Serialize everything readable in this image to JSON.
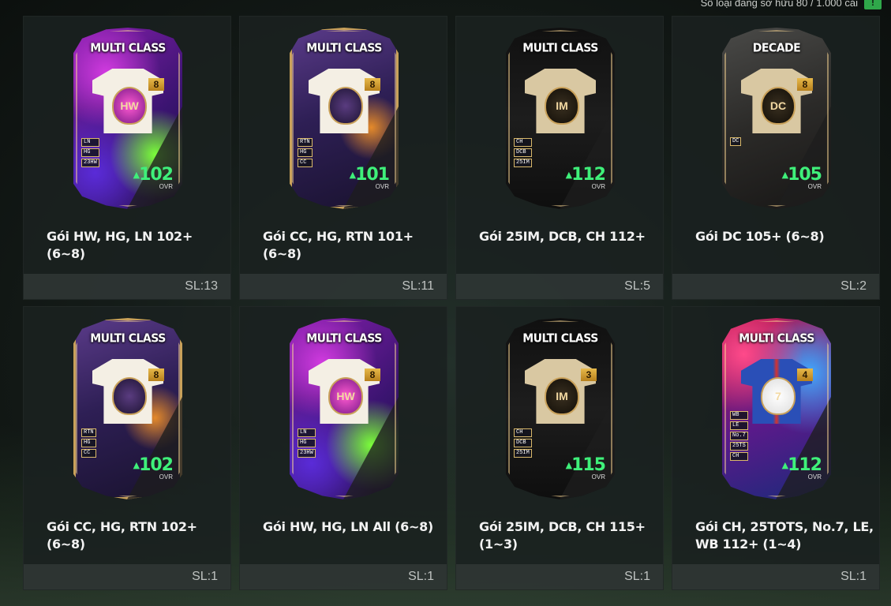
{
  "header": {
    "status_text": "Số loại đang sở hữu 80 / 1.000 cái",
    "action_icon": "!"
  },
  "packs": [
    {
      "title": "MULTI CLASS",
      "theme": "purple",
      "badge": "8",
      "positions": [
        "LN",
        "HG",
        "23HW"
      ],
      "ovr": "102",
      "ovr_label": "OVR",
      "crest": "HW",
      "name": "Gói HW, HG, LN 102+ (6~8)",
      "quantity": "SL:13"
    },
    {
      "title": "MULTI CLASS",
      "theme": "gold",
      "badge": "8",
      "positions": [
        "RTN",
        "HG",
        "CC"
      ],
      "ovr": "101",
      "ovr_label": "OVR",
      "crest": "",
      "name": "Gói CC, HG, RTN 101+ (6~8)",
      "quantity": "SL:11"
    },
    {
      "title": "MULTI CLASS",
      "theme": "black",
      "badge": "",
      "positions": [
        "CH",
        "DCB",
        "25IM"
      ],
      "ovr": "112",
      "ovr_label": "OVR",
      "crest": "IM",
      "name": "Gói 25IM, DCB, CH 112+",
      "quantity": "SL:5"
    },
    {
      "title": "DECADE",
      "theme": "decade",
      "badge": "8",
      "positions": [
        "DC"
      ],
      "ovr": "105",
      "ovr_label": "OVR",
      "crest": "DC",
      "name": "Gói DC 105+ (6~8)",
      "quantity": "SL:2"
    },
    {
      "title": "MULTI CLASS",
      "theme": "gold",
      "badge": "8",
      "positions": [
        "RTN",
        "HG",
        "CC"
      ],
      "ovr": "102",
      "ovr_label": "OVR",
      "crest": "",
      "name": "Gói CC, HG, RTN 102+ (6~8)",
      "quantity": "SL:1"
    },
    {
      "title": "MULTI CLASS",
      "theme": "purple",
      "badge": "8",
      "positions": [
        "LN",
        "HG",
        "23HW"
      ],
      "ovr": "",
      "ovr_label": "",
      "crest": "HW",
      "name": "Gói HW, HG, LN All (6~8)",
      "quantity": "SL:1"
    },
    {
      "title": "MULTI CLASS",
      "theme": "black",
      "badge": "3",
      "positions": [
        "CH",
        "DCB",
        "25IM"
      ],
      "ovr": "115",
      "ovr_label": "OVR",
      "crest": "IM",
      "name": "Gói 25IM, DCB, CH 115+ (1~3)",
      "quantity": "SL:1"
    },
    {
      "title": "MULTI CLASS",
      "theme": "red",
      "badge": "4",
      "positions": [
        "WB",
        "LE",
        "No.7",
        "25TS",
        "CH"
      ],
      "ovr": "112",
      "ovr_label": "OVR",
      "crest": "7",
      "name": "Gói CH, 25TOTS, No.7, LE, WB 112+ (1~4)",
      "quantity": "SL:1"
    }
  ]
}
